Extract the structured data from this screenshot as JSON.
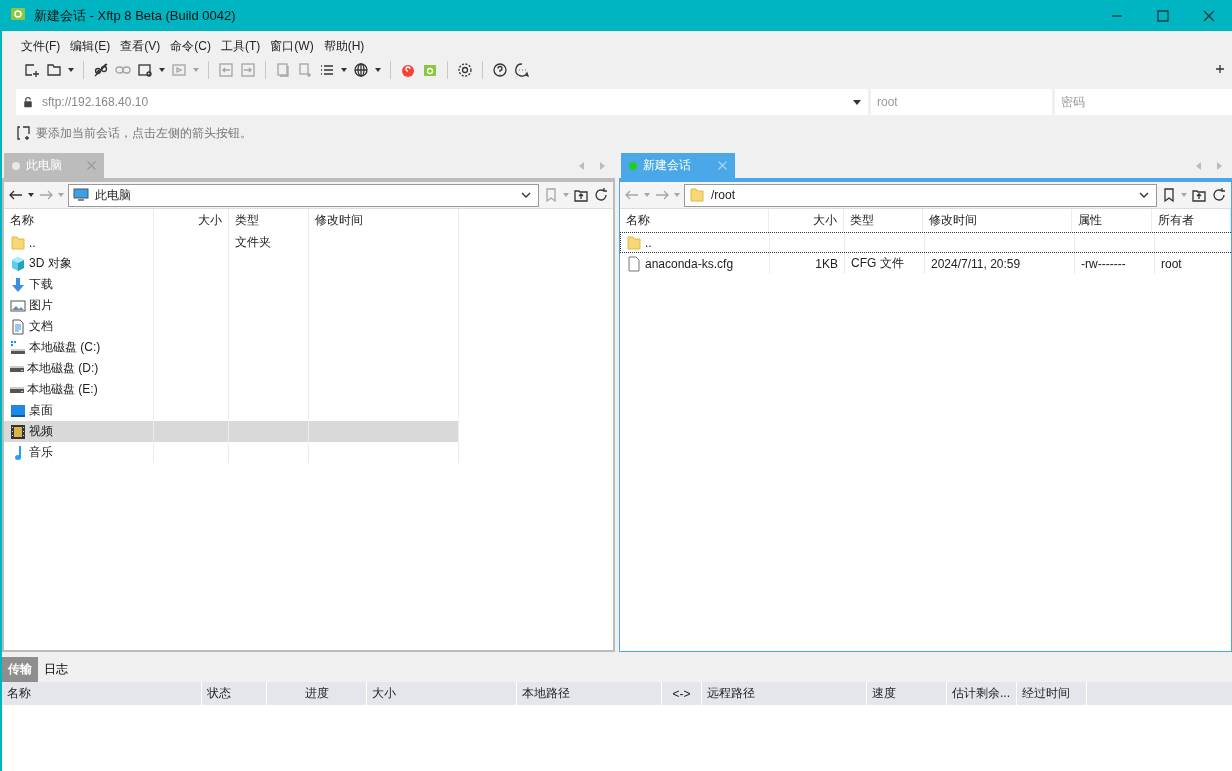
{
  "window": {
    "title": "新建会话 - Xftp 8 Beta (Build 0042)"
  },
  "menu": [
    "文件(F)",
    "编辑(E)",
    "查看(V)",
    "命令(C)",
    "工具(T)",
    "窗口(W)",
    "帮助(H)"
  ],
  "address": {
    "value": "sftp://192.168.40.10",
    "user_placeholder": "root",
    "password_placeholder": "密码"
  },
  "hint": "要添加当前会话，点击左侧的箭头按钮。",
  "panes": [
    {
      "tab": {
        "label": "此电脑",
        "connected": false,
        "selected": false
      },
      "path": {
        "text": "此电脑",
        "kind": "computer"
      },
      "columns": [
        "名称",
        "大小",
        "类型",
        "修改时间"
      ],
      "rows": [
        {
          "kind": "folder",
          "cells": [
            "..",
            "",
            "文件夹",
            ""
          ],
          "selected": false
        },
        {
          "kind": "cube",
          "cells": [
            "3D 对象",
            "",
            "",
            ""
          ],
          "selected": false
        },
        {
          "kind": "download",
          "cells": [
            "下载",
            "",
            "",
            ""
          ],
          "selected": false
        },
        {
          "kind": "picture",
          "cells": [
            "图片",
            "",
            "",
            ""
          ],
          "selected": false
        },
        {
          "kind": "document",
          "cells": [
            "文档",
            "",
            "",
            ""
          ],
          "selected": false
        },
        {
          "kind": "system-drive",
          "cells": [
            "本地磁盘 (C:)",
            "",
            "",
            ""
          ],
          "selected": false
        },
        {
          "kind": "drive",
          "cells": [
            "本地磁盘 (D:)",
            "",
            "",
            ""
          ],
          "selected": false
        },
        {
          "kind": "drive",
          "cells": [
            "本地磁盘 (E:)",
            "",
            "",
            ""
          ],
          "selected": false
        },
        {
          "kind": "desktop",
          "cells": [
            "桌面",
            "",
            "",
            ""
          ],
          "selected": false
        },
        {
          "kind": "video",
          "cells": [
            "视频",
            "",
            "",
            ""
          ],
          "selected": true
        },
        {
          "kind": "music",
          "cells": [
            "音乐",
            "",
            "",
            ""
          ],
          "selected": false
        }
      ]
    },
    {
      "tab": {
        "label": "新建会话",
        "connected": true,
        "selected": true
      },
      "path": {
        "text": "/root",
        "kind": "folder"
      },
      "columns": [
        "名称",
        "大小",
        "类型",
        "修改时间",
        "属性",
        "所有者"
      ],
      "rows": [
        {
          "kind": "folder",
          "cells": [
            "..",
            "",
            "",
            "",
            "",
            ""
          ],
          "selected": false,
          "focused": true
        },
        {
          "kind": "file",
          "cells": [
            "anaconda-ks.cfg",
            "1KB",
            "CFG 文件",
            "2024/7/11, 20:59",
            "-rw-------",
            "root"
          ],
          "selected": false,
          "focused": false
        }
      ]
    }
  ],
  "bottom": {
    "tabs": [
      {
        "label": "传输",
        "selected": true
      },
      {
        "label": "日志",
        "selected": false
      }
    ],
    "columns": [
      "名称",
      "状态",
      "进度",
      "大小",
      "本地路径",
      "<->",
      "远程路径",
      "速度",
      "估计剩余...",
      "经过时间"
    ]
  }
}
